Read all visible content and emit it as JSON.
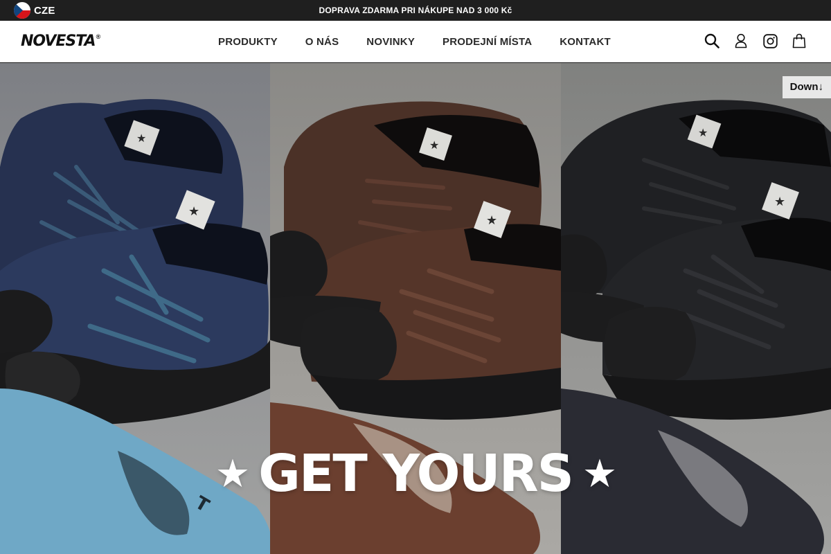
{
  "topbar": {
    "language_label": "CZE",
    "promo_text": "DOPRAVA ZDARMA PRI NÁKUPE NAD 3 000 Kč"
  },
  "header": {
    "logo_text": "NOVESTA",
    "logo_mark": "®",
    "nav": [
      {
        "label": "PRODUKTY"
      },
      {
        "label": "O NÁS"
      },
      {
        "label": "NOVINKY"
      },
      {
        "label": "PRODEJNÍ MÍSTA"
      },
      {
        "label": "KONTAKT"
      }
    ],
    "icons": [
      "search-icon",
      "user-icon",
      "instagram-icon",
      "shopping-bag-icon"
    ]
  },
  "hero": {
    "down_label": "Down↓",
    "star_glyph": "★",
    "tagline": "GET YOURS",
    "shoe_colors": [
      "#2a3552",
      "#4e342b",
      "#1e1f22"
    ],
    "insole_colors": [
      "#6fa8c6",
      "#6b3f2f",
      "#2a2b33"
    ]
  },
  "colors": {
    "topbar_bg": "#1f1f1f",
    "text": "#2b2b2b"
  }
}
